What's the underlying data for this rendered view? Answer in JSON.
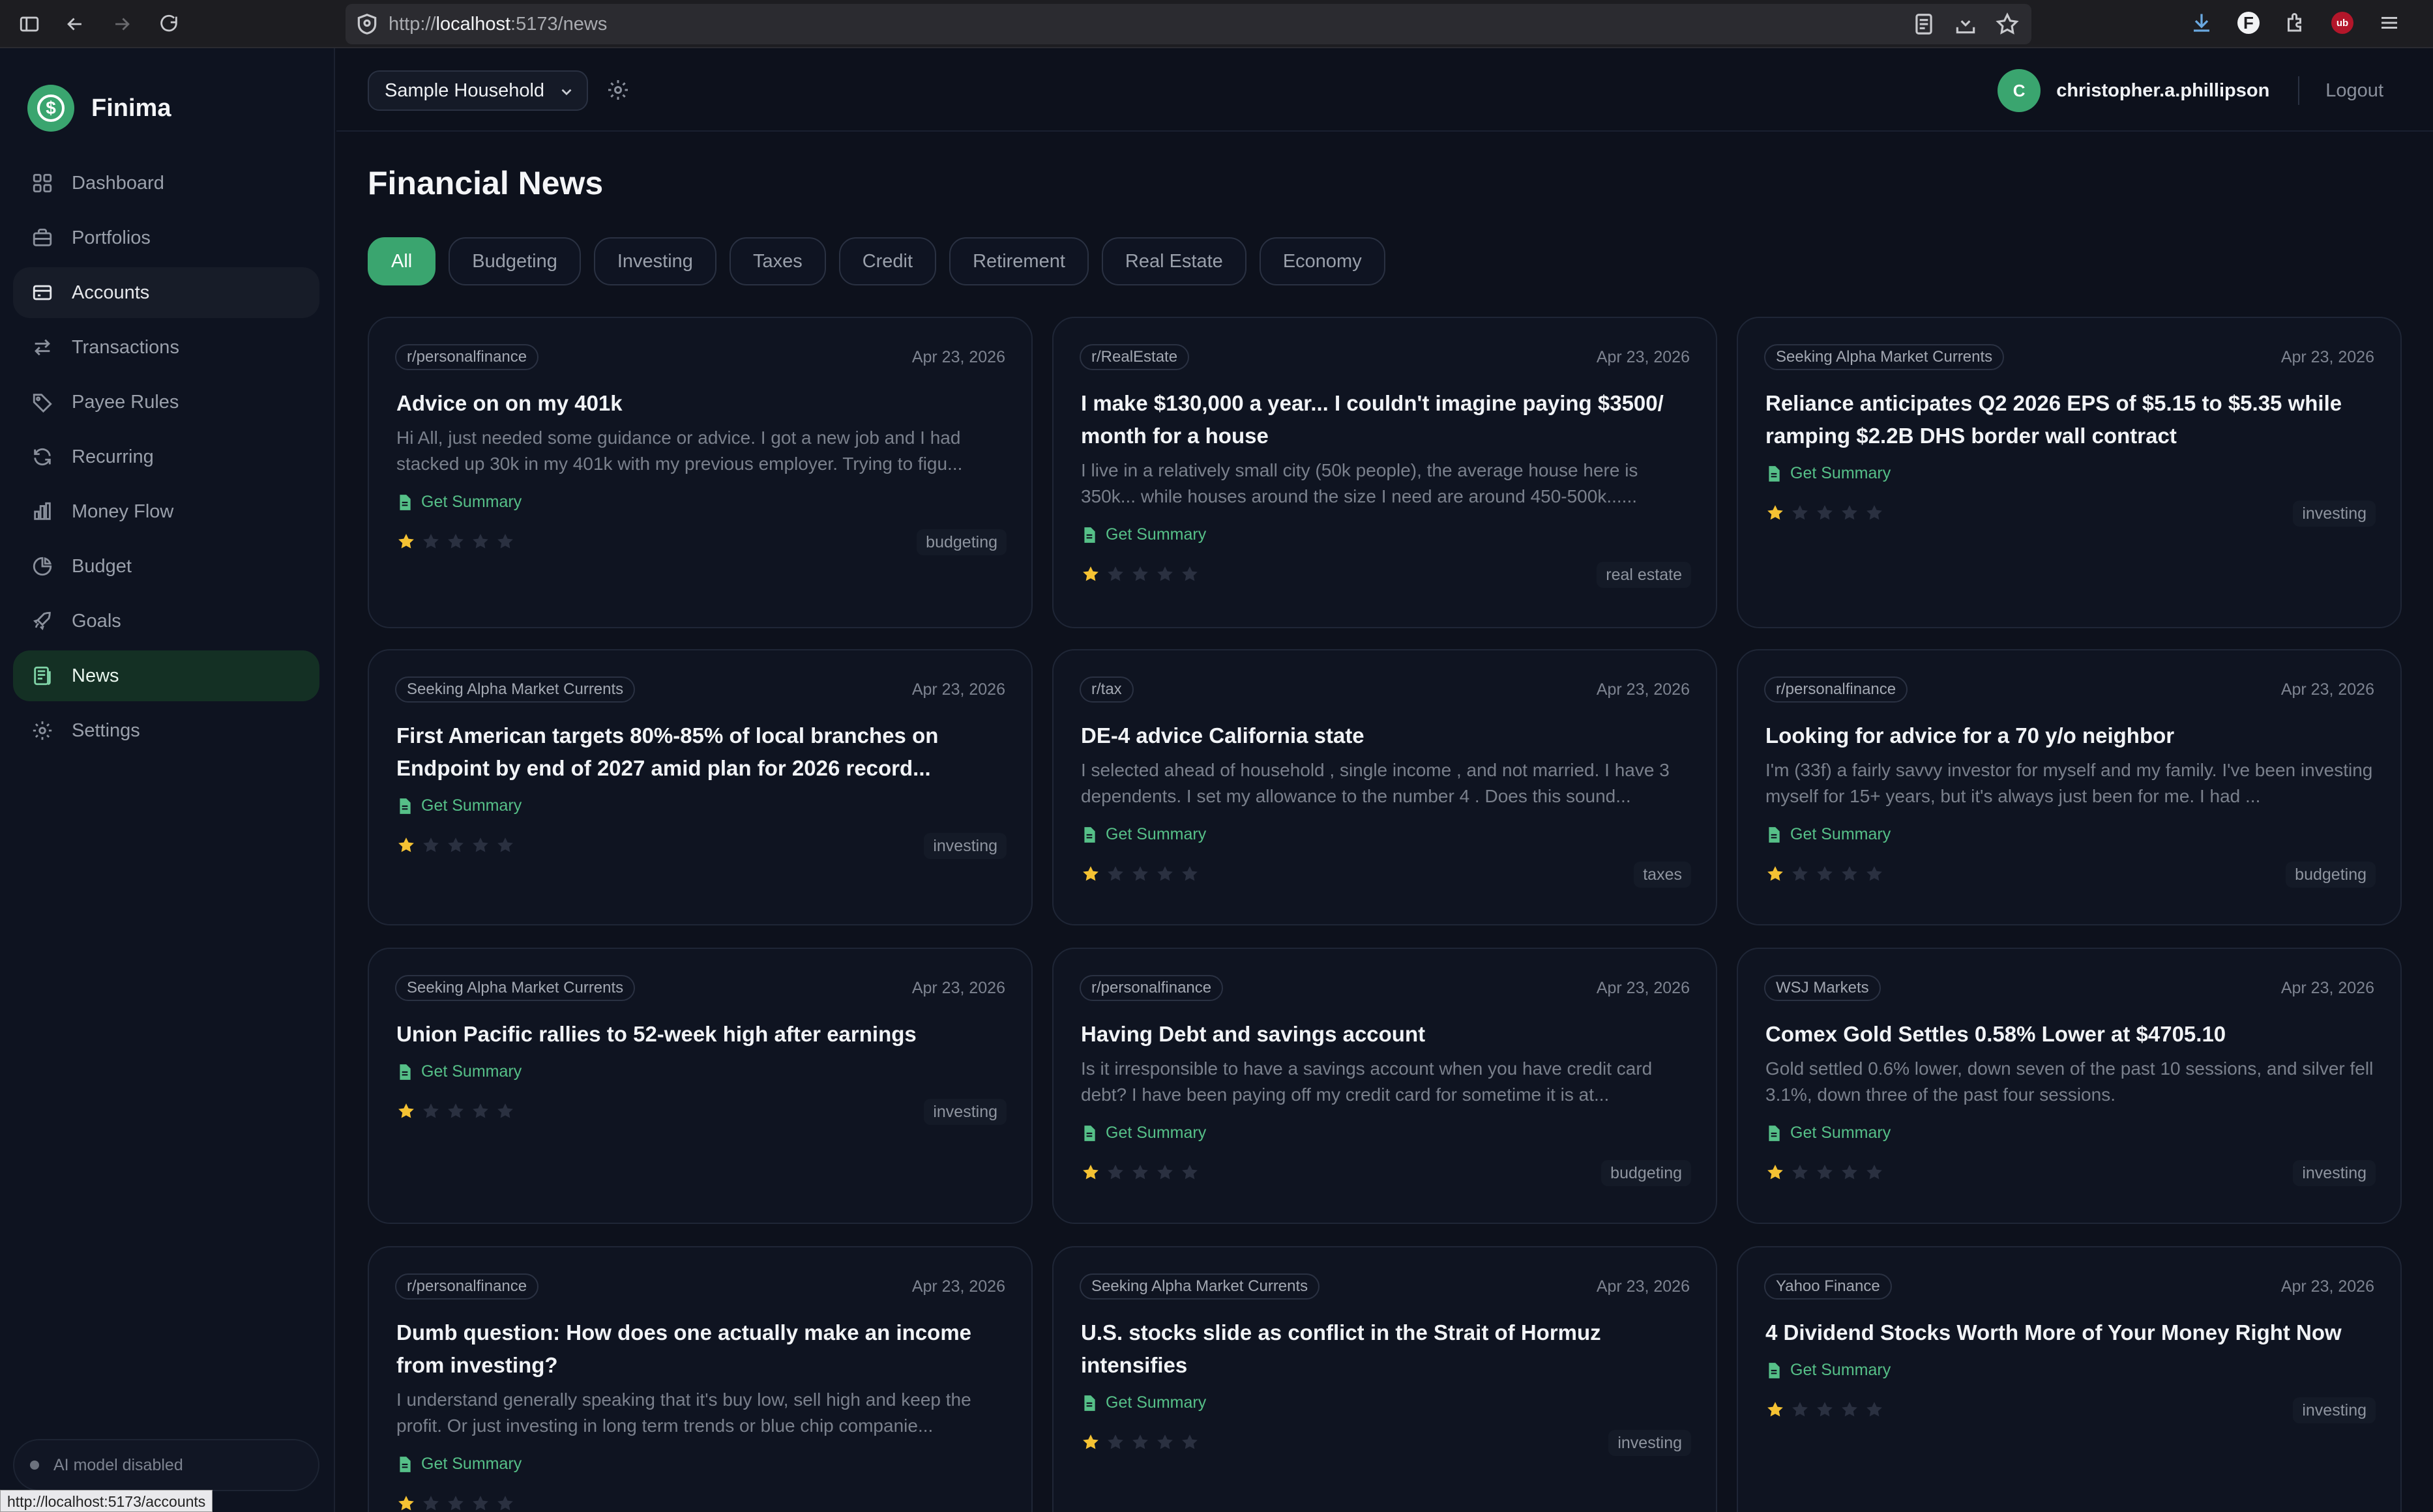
{
  "browser": {
    "url_prefix": "http://",
    "url_host": "localhost",
    "url_rest": ":5173/news",
    "status_url": "http://localhost:5173/accounts"
  },
  "app": {
    "name": "Finima",
    "accent_color": "#3aa56f"
  },
  "sidebar": {
    "items": [
      {
        "label": "Dashboard",
        "icon": "grid-icon"
      },
      {
        "label": "Portfolios",
        "icon": "briefcase-icon"
      },
      {
        "label": "Accounts",
        "icon": "card-icon"
      },
      {
        "label": "Transactions",
        "icon": "arrows-icon"
      },
      {
        "label": "Payee Rules",
        "icon": "tag-icon"
      },
      {
        "label": "Recurring",
        "icon": "refresh-icon"
      },
      {
        "label": "Money Flow",
        "icon": "bar-chart-icon"
      },
      {
        "label": "Budget",
        "icon": "pie-icon"
      },
      {
        "label": "Goals",
        "icon": "rocket-icon"
      },
      {
        "label": "News",
        "icon": "newspaper-icon"
      },
      {
        "label": "Settings",
        "icon": "gear-icon"
      }
    ],
    "ai_status": "AI model disabled"
  },
  "header": {
    "household": "Sample Household",
    "avatar_initial": "C",
    "username": "christopher.a.phillipson",
    "logout": "Logout"
  },
  "page": {
    "title": "Financial News",
    "filters": [
      "All",
      "Budgeting",
      "Investing",
      "Taxes",
      "Credit",
      "Retirement",
      "Real Estate",
      "Economy"
    ],
    "active_filter": "All"
  },
  "articles": [
    {
      "source": "r/personalfinance",
      "date": "Apr 23, 2026",
      "title": "Advice on on my 401k",
      "snippet": "Hi All, just needed some guidance or advice. I got a new job and I had stacked up 30k in my 401k with my previous employer. Trying to figu...",
      "summary": "Get Summary",
      "rating": 1,
      "tag": "budgeting"
    },
    {
      "source": "r/RealEstate",
      "date": "Apr 23, 2026",
      "title": "I make $130,000 a year... I couldn't imagine paying $3500/ month for a house",
      "snippet": "I live in a relatively small city (50k people), the average house here is 350k... while houses around the size I need are around 450-500k......",
      "summary": "Get Summary",
      "rating": 1,
      "tag": "real estate"
    },
    {
      "source": "Seeking Alpha Market Currents",
      "date": "Apr 23, 2026",
      "title": "Reliance anticipates Q2 2026 EPS of $5.15 to $5.35 while ramping $2.2B DHS border wall contract",
      "snippet": "",
      "summary": "Get Summary",
      "rating": 1,
      "tag": "investing"
    },
    {
      "source": "Seeking Alpha Market Currents",
      "date": "Apr 23, 2026",
      "title": "First American targets 80%-85% of local branches on Endpoint by end of 2027 amid plan for 2026 record...",
      "snippet": "",
      "summary": "Get Summary",
      "rating": 1,
      "tag": "investing"
    },
    {
      "source": "r/tax",
      "date": "Apr 23, 2026",
      "title": "DE-4 advice California state",
      "snippet": "I selected ahead of household , single income , and not married. I have 3 dependents. I set my allowance to the number 4 . Does this sound...",
      "summary": "Get Summary",
      "rating": 1,
      "tag": "taxes"
    },
    {
      "source": "r/personalfinance",
      "date": "Apr 23, 2026",
      "title": "Looking for advice for a 70 y/o neighbor",
      "snippet": "I'm (33f) a fairly savvy investor for myself and my family. I've been investing myself for 15+ years, but it's always just been for me. I had ...",
      "summary": "Get Summary",
      "rating": 1,
      "tag": "budgeting"
    },
    {
      "source": "Seeking Alpha Market Currents",
      "date": "Apr 23, 2026",
      "title": "Union Pacific rallies to 52-week high after earnings",
      "snippet": "",
      "summary": "Get Summary",
      "rating": 1,
      "tag": "investing"
    },
    {
      "source": "r/personalfinance",
      "date": "Apr 23, 2026",
      "title": "Having Debt and savings account",
      "snippet": "Is it irresponsible to have a savings account when you have credit card debt? I have been paying off my credit card for sometime it is at...",
      "summary": "Get Summary",
      "rating": 1,
      "tag": "budgeting"
    },
    {
      "source": "WSJ Markets",
      "date": "Apr 23, 2026",
      "title": "Comex Gold Settles 0.58% Lower at $4705.10",
      "snippet": "Gold settled 0.6% lower, down seven of the past 10 sessions, and silver fell 3.1%, down three of the past four sessions.",
      "summary": "Get Summary",
      "rating": 1,
      "tag": "investing"
    },
    {
      "source": "r/personalfinance",
      "date": "Apr 23, 2026",
      "title": "Dumb question: How does one actually make an income from investing?",
      "snippet": "I understand generally speaking that it's buy low, sell high and keep the profit. Or just investing in long term trends or blue chip companie...",
      "summary": "Get Summary",
      "rating": 1,
      "tag": ""
    },
    {
      "source": "Seeking Alpha Market Currents",
      "date": "Apr 23, 2026",
      "title": "U.S. stocks slide as conflict in the Strait of Hormuz intensifies",
      "snippet": "",
      "summary": "Get Summary",
      "rating": 1,
      "tag": "investing"
    },
    {
      "source": "Yahoo Finance",
      "date": "Apr 23, 2026",
      "title": "4 Dividend Stocks Worth More of Your Money Right Now",
      "snippet": "",
      "summary": "Get Summary",
      "rating": 1,
      "tag": "investing"
    }
  ]
}
